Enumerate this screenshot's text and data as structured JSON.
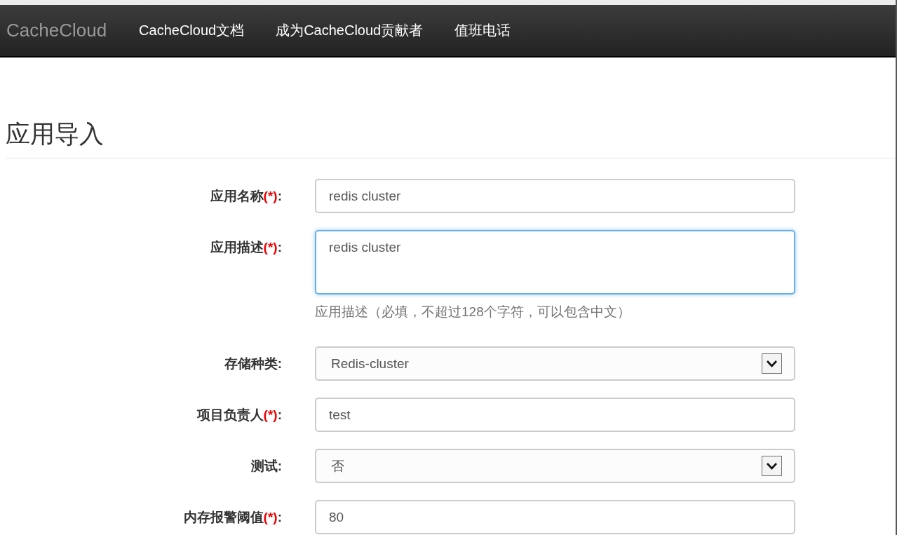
{
  "navbar": {
    "brand": "CacheCloud",
    "links": [
      "CacheCloud文档",
      "成为CacheCloud贡献者",
      "值班电话"
    ]
  },
  "page_title": "应用导入",
  "form": {
    "fields": [
      {
        "kind": "input",
        "label": "应用名称",
        "required_mark": "(*)",
        "colon": ":",
        "value": "redis cluster",
        "focused": false
      },
      {
        "kind": "textarea",
        "label": "应用描述",
        "required_mark": "(*)",
        "colon": ":",
        "value": "redis cluster",
        "focused": true,
        "help": "应用描述（必填，不超过128个字符，可以包含中文）"
      },
      {
        "kind": "select",
        "label": "存储种类",
        "colon": ":",
        "value": "Redis-cluster",
        "focused": false
      },
      {
        "kind": "input",
        "label": "项目负责人",
        "required_mark": "(*)",
        "colon": ":",
        "value": "test",
        "focused": false
      },
      {
        "kind": "select",
        "label": "测试",
        "colon": ":",
        "value": "否",
        "focused": false
      },
      {
        "kind": "input",
        "label": "内存报警阈值",
        "required_mark": "(*)",
        "colon": ":",
        "value": "80",
        "focused": false
      }
    ]
  }
}
